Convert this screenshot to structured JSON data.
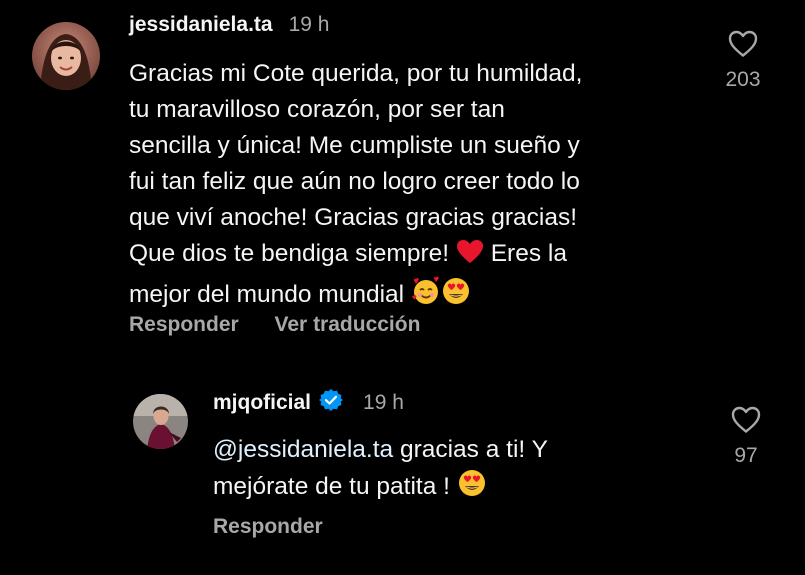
{
  "comment": {
    "username": "jessidaniela.ta",
    "time": "19 h",
    "text_lines": [
      "Gracias mi Cote querida, por tu humildad,",
      "tu maravilloso corazón, por ser tan",
      "sencilla y única! Me cumpliste un sueño y",
      "fui tan feliz que aún no logro creer todo lo",
      "que viví anoche! Gracias gracias gracias!",
      "Que dios te bendiga siempre!",
      "Eres la",
      "mejor del mundo mundial"
    ],
    "reply_label": "Responder",
    "translate_label": "Ver traducción",
    "likes": "203"
  },
  "reply": {
    "username": "mjqoficial",
    "time": "19 h",
    "mention": "@jessidaniela.ta",
    "text_line1_rest": " gracias a ti! Y",
    "text_line2": "mejórate de tu patita !",
    "reply_label": "Responder",
    "likes": "97"
  },
  "icons": {
    "heart_outline": "heart-outline-icon",
    "red_heart": "red-heart-emoji",
    "smiling_hearts": "smiling-face-with-hearts-emoji",
    "heart_eyes": "heart-eyes-emoji",
    "verified": "verified-badge-icon"
  },
  "colors": {
    "background": "#000000",
    "text": "#f5f5f5",
    "secondary": "#a8a8a8",
    "verified": "#0095f6",
    "heart_red": "#e8162d"
  }
}
